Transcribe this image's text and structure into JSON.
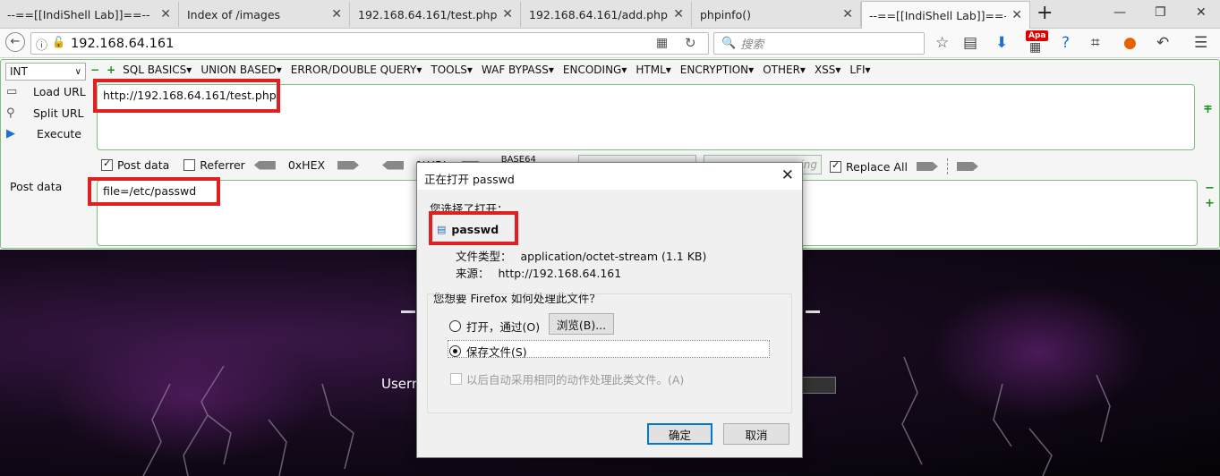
{
  "tabs": [
    {
      "title": "--==[[IndiShell Lab]]==--",
      "active": false
    },
    {
      "title": "Index of /images",
      "active": false
    },
    {
      "title": "192.168.64.161/test.php",
      "active": false
    },
    {
      "title": "192.168.64.161/add.php",
      "active": false
    },
    {
      "title": "phpinfo()",
      "active": false
    },
    {
      "title": "--==[[IndiShell Lab]]==--",
      "active": true
    }
  ],
  "nav": {
    "url": "192.168.64.161",
    "search_placeholder": "搜索",
    "apa_badge": "Apa"
  },
  "hackbar": {
    "mode": "INT",
    "menu": [
      "SQL BASICS▾",
      "UNION BASED▾",
      "ERROR/DOUBLE QUERY▾",
      "TOOLS▾",
      "WAF BYPASS▾",
      "ENCODING▾",
      "HTML▾",
      "ENCRYPTION▾",
      "OTHER▾",
      "XSS▾",
      "LFI▾"
    ],
    "load_url": "Load URL",
    "split_url": "Split URL",
    "execute": "Execute",
    "url_value": "http://192.168.64.161/test.php",
    "post_data_checkbox": "Post data",
    "referrer_checkbox": "Referrer",
    "hex_label": "0xHEX",
    "url_label": "%URL",
    "base64_label": "BASE64",
    "ghost_right": "ing",
    "replace_all": "Replace All",
    "post_data_label": "Post data",
    "post_value": "file=/etc/passwd"
  },
  "page": {
    "username_label": "Userr"
  },
  "dialog": {
    "title": "正在打开 passwd",
    "chose_label": "您选择了打开：",
    "filename": "passwd",
    "filetype_key": "文件类型：",
    "filetype_val": "application/octet-stream (1.1 KB)",
    "source_key": "来源：",
    "source_val": "http://192.168.64.161",
    "question": "您想要 Firefox 如何处理此文件？",
    "open_with": "打开，通过(O)",
    "browse": "浏览(B)...",
    "save_file": "保存文件(S)",
    "auto_action": "以后自动采用相同的动作处理此类文件。(A)",
    "ok": "确定",
    "cancel": "取消"
  }
}
